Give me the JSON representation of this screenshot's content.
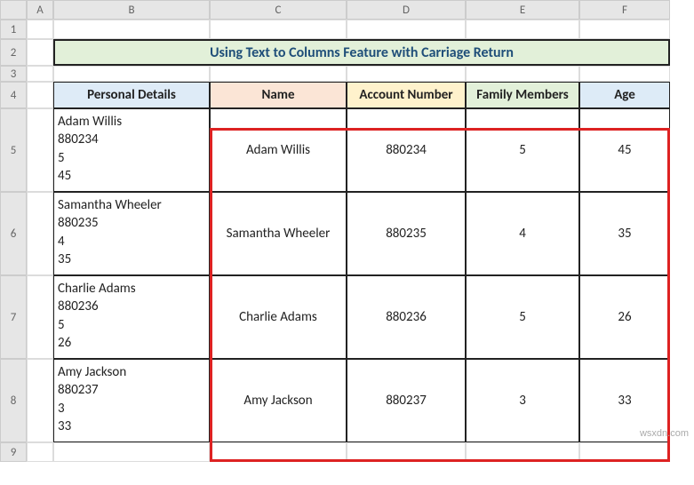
{
  "columns": [
    "A",
    "B",
    "C",
    "D",
    "E",
    "F"
  ],
  "rows": [
    "1",
    "2",
    "3",
    "4",
    "5",
    "6",
    "7",
    "8",
    "9"
  ],
  "title": "Using Text to Columns Feature with Carriage Return",
  "headers": {
    "b": "Personal Details",
    "c": "Name",
    "d": "Account Number",
    "e": "Family Members",
    "f": "Age"
  },
  "data": [
    {
      "raw": "Adam Willis\n880234\n5\n45",
      "name": "Adam Willis",
      "account": "880234",
      "members": "5",
      "age": "45"
    },
    {
      "raw": "Samantha Wheeler\n880235\n4\n35",
      "name": "Samantha Wheeler",
      "account": "880235",
      "members": "4",
      "age": "35"
    },
    {
      "raw": "Charlie Adams\n880236\n5\n26",
      "name": "Charlie Adams",
      "account": "880236",
      "members": "5",
      "age": "26"
    },
    {
      "raw": "Amy Jackson\n880237\n3\n33",
      "name": "Amy Jackson",
      "account": "880237",
      "members": "3",
      "age": "33"
    }
  ],
  "watermark": "wsxdn.com"
}
